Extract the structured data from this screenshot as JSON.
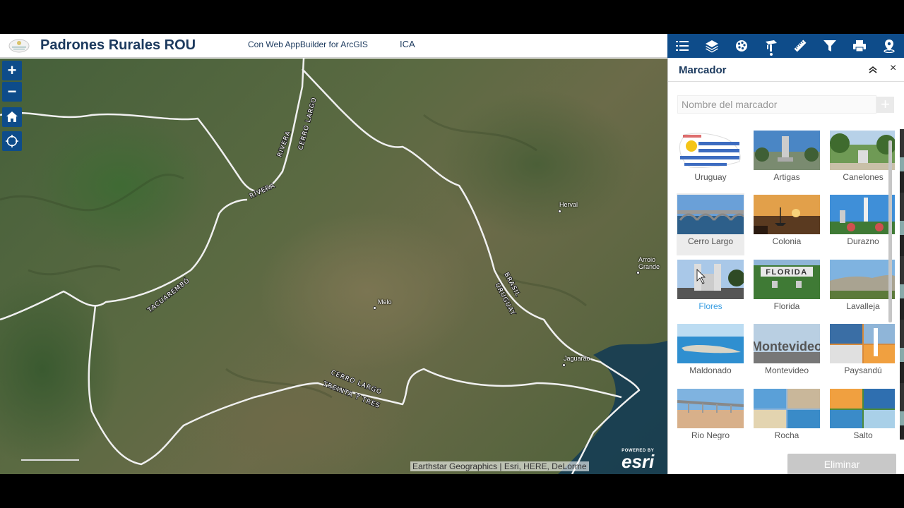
{
  "header": {
    "title": "Padrones Rurales ROU",
    "subtitle": "Con Web AppBuilder for ArcGIS",
    "link": "ICA"
  },
  "toolbar": {
    "tools": [
      {
        "name": "list",
        "icon": "list-icon"
      },
      {
        "name": "layers",
        "icon": "layers-icon"
      },
      {
        "name": "basemap",
        "icon": "basemap-gallery-icon"
      },
      {
        "name": "bookmark",
        "icon": "bookmark-icon",
        "active": true
      },
      {
        "name": "measure",
        "icon": "ruler-icon"
      },
      {
        "name": "filter",
        "icon": "filter-icon"
      },
      {
        "name": "print",
        "icon": "print-icon"
      },
      {
        "name": "locate",
        "icon": "location-icon"
      }
    ]
  },
  "map": {
    "controls": {
      "zoom_in": "+",
      "zoom_out": "−"
    },
    "places": [
      "Herval",
      "Arroio Grande",
      "Melo",
      "Jaguarão"
    ],
    "regions": [
      "RIVERA",
      "CERRO LARGO",
      "TACUAREMBÓ",
      "BRASIL",
      "URUGUAY",
      "CERRO LARGO",
      "TREINTA Y TRES"
    ],
    "attribution": "Earthstar Geographics | Esri, HERE, DeLorme",
    "esri_powered": "POWERED BY",
    "esri_word": "esri"
  },
  "panel": {
    "title": "Marcador",
    "close": "×",
    "input_placeholder": "Nombre del marcador",
    "add": "+",
    "bookmarks": [
      "Uruguay",
      "Artigas",
      "Canelones",
      "Cerro Largo",
      "Colonia",
      "Durazno",
      "Flores",
      "Florida",
      "Lavalleja",
      "Maldonado",
      "Montevideo",
      "Paysandú",
      "Rio Negro",
      "Rocha",
      "Salto"
    ],
    "selected": "Cerro Largo",
    "hovered": "Flores",
    "delete_label": "Eliminar",
    "florida_sign": "FLORIDA",
    "montevideo_sign": "Montevideo"
  },
  "colors": {
    "toolbar_bg": "#0e4c8a",
    "title": "#1c3a5e",
    "hover_link": "#3a9ee2"
  }
}
